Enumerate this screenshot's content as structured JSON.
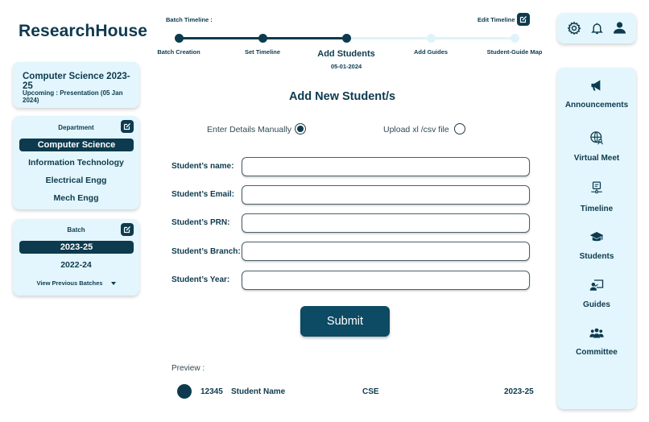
{
  "brand": "ResearchHouse",
  "info_card": {
    "title": "Computer Science 2023-25",
    "upcoming": "Upcoming : Presentation (05 Jan 2024)"
  },
  "department": {
    "label": "Department",
    "selected": "Computer Science",
    "items": [
      "Information Technology",
      "Electrical Engg",
      "Mech Engg"
    ]
  },
  "batch": {
    "label": "Batch",
    "selected": "2023-25",
    "items": [
      "2022-24"
    ],
    "view_previous": "View Previous Batches"
  },
  "timeline": {
    "label": "Batch Timeline :",
    "edit_label": "Edit Timeline",
    "steps": [
      {
        "label": "Batch Creation",
        "state": "done"
      },
      {
        "label": "Set Timeline",
        "state": "done"
      },
      {
        "label": "Add Students",
        "state": "current",
        "date": "05-01-2024"
      },
      {
        "label": "Add Guides",
        "state": "pending"
      },
      {
        "label": "Student-Guide Map",
        "state": "pending"
      }
    ],
    "colors": {
      "done": "#0d3a4e",
      "pending": "#dff3fb"
    }
  },
  "form": {
    "title": "Add New Student/s",
    "option_manual": "Enter Details Manually",
    "option_upload": "Upload xl /csv file",
    "selected_option": "manual",
    "fields": [
      {
        "label": "Student’s name:",
        "value": ""
      },
      {
        "label": "Student’s Email:",
        "value": ""
      },
      {
        "label": "Student’s PRN:",
        "value": ""
      },
      {
        "label": "Student’s Branch:",
        "value": ""
      },
      {
        "label": "Student’s Year:",
        "value": ""
      }
    ],
    "submit_label": "Submit"
  },
  "preview": {
    "label": "Preview :",
    "row": {
      "prn": "12345",
      "name": "Student Name",
      "branch": "CSE",
      "batch": "2023-25"
    }
  },
  "top_icons": [
    "gear-icon",
    "bell-icon",
    "user-icon"
  ],
  "nav": [
    {
      "label": "Announcements",
      "icon": "megaphone-icon"
    },
    {
      "label": "Virtual Meet",
      "icon": "globe-user-icon"
    },
    {
      "label": "Timeline",
      "icon": "timeline-icon"
    },
    {
      "label": "Students",
      "icon": "graduation-cap-icon"
    },
    {
      "label": "Guides",
      "icon": "presenter-icon"
    },
    {
      "label": "Committee",
      "icon": "group-icon"
    }
  ],
  "colors": {
    "primary": "#0d3a4e",
    "card_bg": "#e3f6fd"
  }
}
